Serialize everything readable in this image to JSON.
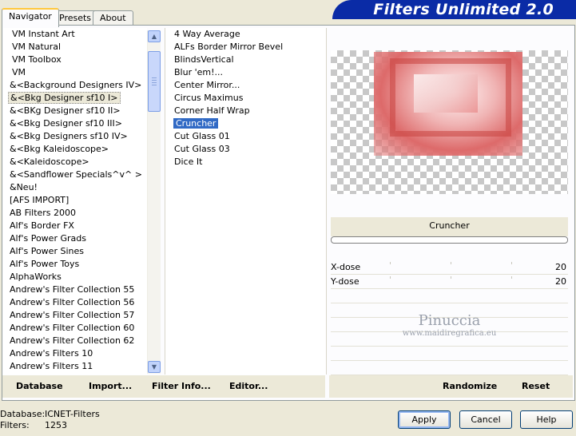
{
  "tabs": [
    "Navigator",
    "Presets",
    "About"
  ],
  "banner_title": "Filters Unlimited 2.0",
  "categories": [
    "VM Instant Art",
    "VM Natural",
    "VM Toolbox",
    "VM",
    "&<Background Designers IV>",
    "&<Bkg Designer sf10 I>",
    "&<BKg Designer sf10 II>",
    "&<Bkg Designer sf10 III>",
    "&<Bkg Designers sf10 IV>",
    "&<Bkg Kaleidoscope>",
    "&<Kaleidoscope>",
    "&<Sandflower Specials^v^ >",
    "&Neu!",
    "[AFS IMPORT]",
    "AB Filters 2000",
    "Alf's Border FX",
    "Alf's Power Grads",
    "Alf's Power Sines",
    "Alf's Power Toys",
    "AlphaWorks",
    "Andrew's Filter Collection 55",
    "Andrew's Filter Collection 56",
    "Andrew's Filter Collection 57",
    "Andrew's Filter Collection 60",
    "Andrew's Filter Collection 62",
    "Andrew's Filters 10",
    "Andrew's Filters 11"
  ],
  "selected_category_index": 5,
  "filters": [
    "4 Way Average",
    "ALFs Border Mirror Bevel",
    "BlindsVertical",
    "Blur 'em!...",
    "Center Mirror...",
    "Circus Maximus",
    "Corner Half Wrap",
    "Cruncher",
    "Cut Glass 01",
    "Cut Glass 03",
    "Dice It"
  ],
  "selected_filter_index": 7,
  "preview_filter_name": "Cruncher",
  "params": [
    {
      "label": "X-dose",
      "value": "20"
    },
    {
      "label": "Y-dose",
      "value": "20"
    }
  ],
  "watermark": {
    "name": "Pinuccia",
    "site": "www.maidiregrafica.eu"
  },
  "left_buttons": {
    "database": "Database",
    "import": "Import...",
    "filter_info": "Filter Info...",
    "editor": "Editor..."
  },
  "right_buttons": {
    "randomize": "Randomize",
    "reset": "Reset"
  },
  "status": {
    "database_label": "Database:",
    "database_value": "ICNET-Filters",
    "filters_label": "Filters:",
    "filters_value": "1253"
  },
  "dialog_buttons": {
    "apply": "Apply",
    "cancel": "Cancel",
    "help": "Help"
  }
}
